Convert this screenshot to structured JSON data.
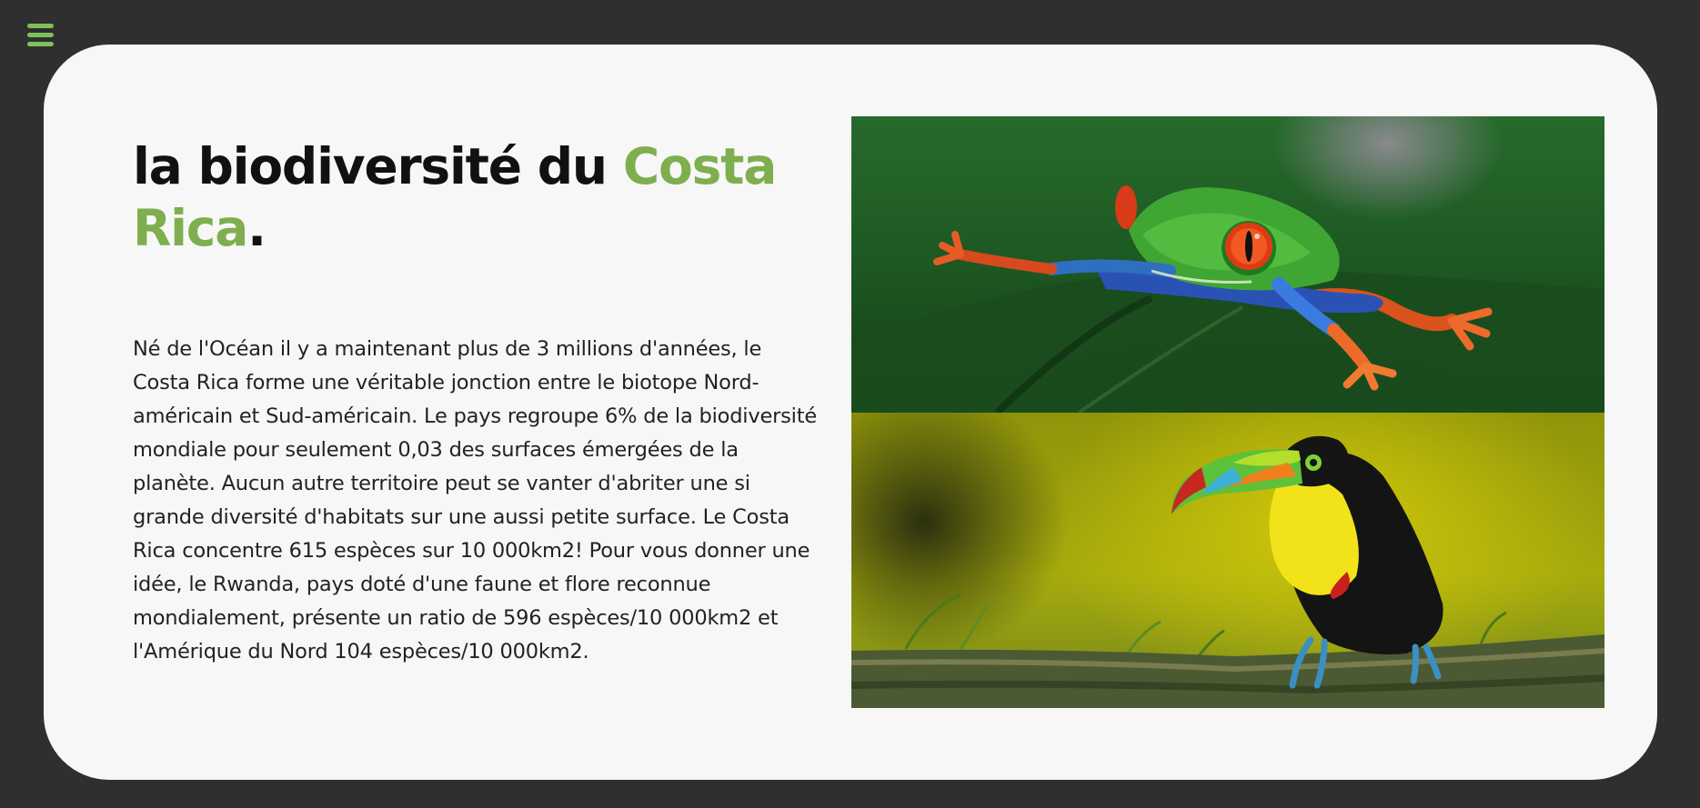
{
  "nav": {
    "menu_icon": "hamburger-menu-icon",
    "accent_color": "#7ec15a"
  },
  "hero": {
    "title_prefix": "la biodiversité du ",
    "title_highlight": "Costa Rica",
    "title_suffix": ".",
    "highlight_color": "#7eae4e",
    "body": "Né de l'Océan il y a maintenant plus de 3 millions d'années, le Costa Rica forme une véritable jonction entre le biotope Nord-américain et Sud-américain. Le pays regroupe 6% de la biodiversité mondiale pour seulement 0,03 des surfaces émergées de la planète. Aucun autre territoire peut se vanter d'abriter une si grande diversité d'habitats sur une aussi petite surface. Le Costa Rica concentre 615 espèces sur 10 000km2! Pour vous donner une idée, le Rwanda, pays doté d'une faune et flore reconnue mondialement, présente un ratio de 596 espèces/10 000km2 et l'Amérique du Nord 104 espèces/10 000km2."
  },
  "media": {
    "photos": [
      "red-eyed-tree-frog",
      "keel-billed-toucan"
    ]
  }
}
